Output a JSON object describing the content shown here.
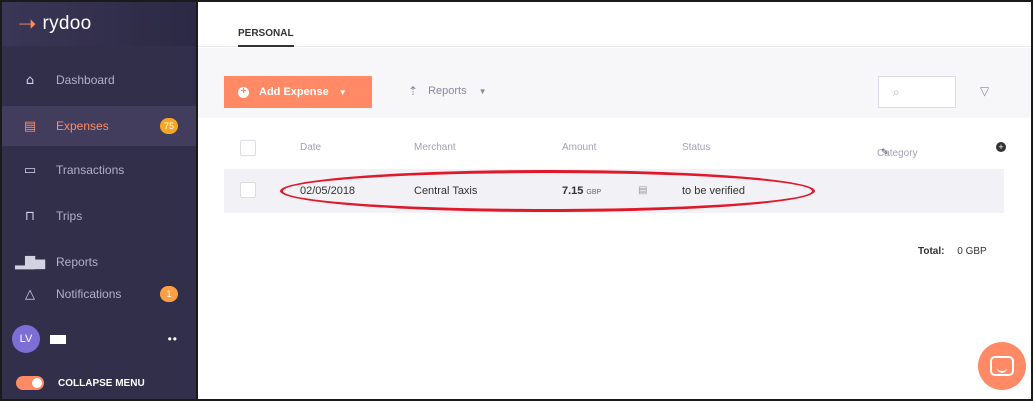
{
  "app": {
    "brand": "rydoo"
  },
  "sidebar": {
    "items": [
      {
        "label": "Dashboard",
        "icon": "home-icon"
      },
      {
        "label": "Expenses",
        "icon": "receipt-icon",
        "badge": "75",
        "active": true
      },
      {
        "label": "Transactions",
        "icon": "card-icon"
      },
      {
        "label": "Trips",
        "icon": "suitcase-icon"
      },
      {
        "label": "Reports",
        "icon": "bar-chart-icon"
      },
      {
        "label": "Notifications",
        "icon": "bell-icon",
        "badge": "1"
      }
    ],
    "user": {
      "initials": "LV",
      "menu": "••"
    },
    "collapse_label": "COLLAPSE MENU"
  },
  "header": {
    "tab": "PERSONAL"
  },
  "toolbar": {
    "add_label": "Add Expense",
    "reports_label": "Reports"
  },
  "table": {
    "headers": {
      "date": "Date",
      "merchant": "Merchant",
      "amount": "Amount",
      "status": "Status",
      "category": "Category"
    },
    "rows": [
      {
        "date": "02/05/2018",
        "merchant": "Central Taxis",
        "amount": "7.15",
        "currency": "GBP",
        "status": "to be verified"
      }
    ]
  },
  "total": {
    "label": "Total:",
    "value": "0 GBP"
  },
  "colors": {
    "accent": "#ff8a65",
    "sidebar": "#322f4a",
    "highlight": "#e0182a"
  }
}
